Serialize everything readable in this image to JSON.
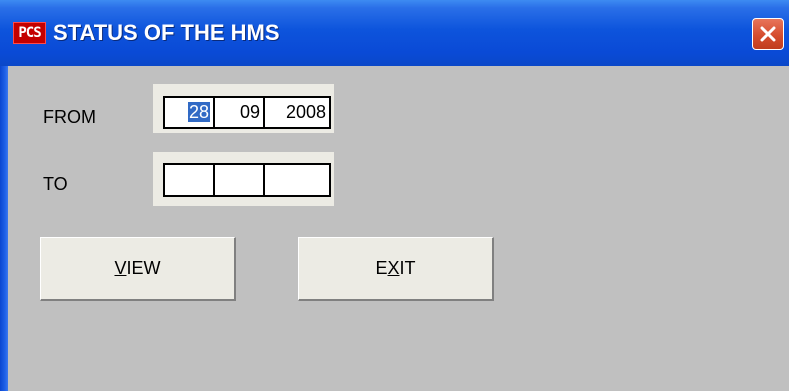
{
  "window": {
    "title": "STATUS OF THE HMS",
    "icon_label": "PCS",
    "close_icon": "close-icon"
  },
  "form": {
    "from_label": "FROM",
    "to_label": "TO",
    "from": {
      "day": "28",
      "month": "09",
      "year": "2008"
    },
    "to": {
      "day": "",
      "month": "",
      "year": ""
    }
  },
  "buttons": {
    "view": {
      "mnemonic": "V",
      "rest": "IEW"
    },
    "exit": {
      "prefix": "E",
      "mnemonic": "X",
      "rest": "IT"
    }
  },
  "colors": {
    "titlebar": "#0a4ad6",
    "client": "#c0c0c0",
    "button_face": "#ecebe4",
    "selection": "#316ac5",
    "close": "#d54d2e"
  }
}
